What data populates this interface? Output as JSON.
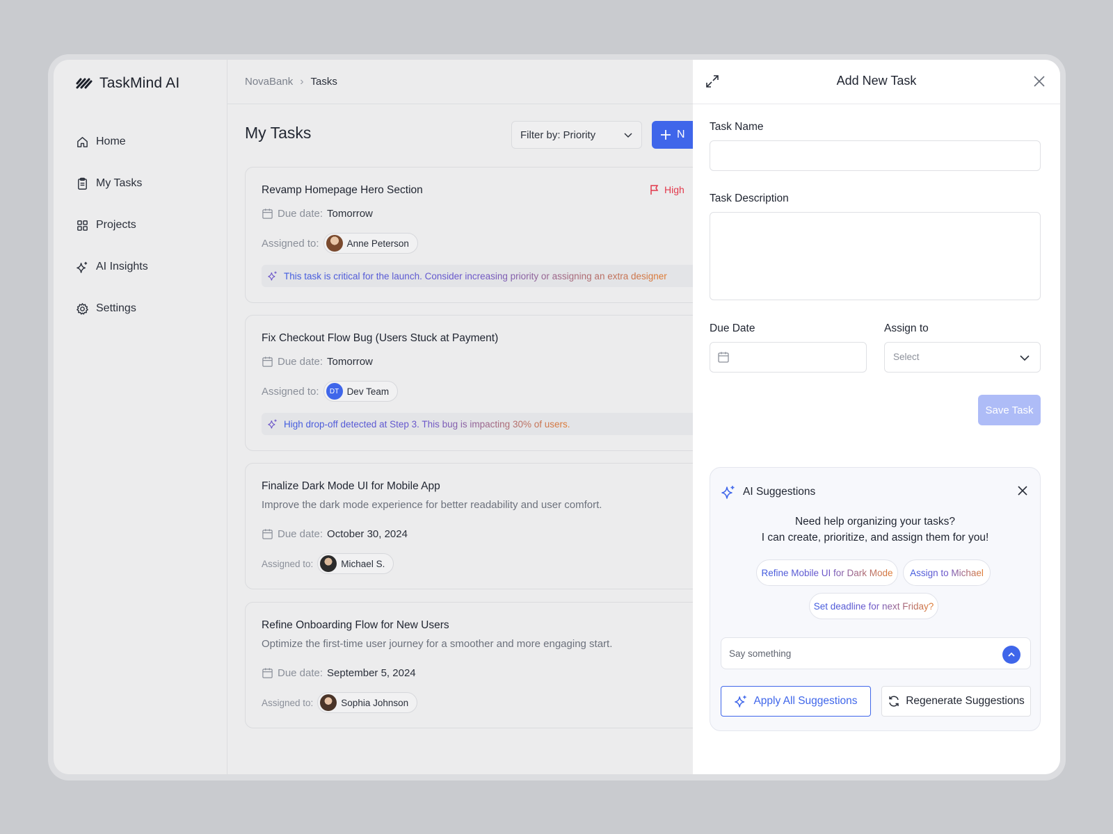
{
  "app": {
    "name": "TaskMind AI"
  },
  "sidebar": {
    "items": [
      {
        "label": "Home",
        "icon": "home-icon"
      },
      {
        "label": "My Tasks",
        "icon": "clipboard-icon"
      },
      {
        "label": "Projects",
        "icon": "grid-icon"
      },
      {
        "label": "AI Insights",
        "icon": "sparkle-icon"
      },
      {
        "label": "Settings",
        "icon": "gear-icon"
      }
    ]
  },
  "breadcrumb": {
    "parent": "NovaBank",
    "current": "Tasks"
  },
  "main": {
    "title": "My Tasks",
    "filter": {
      "prefix": "Filter by:",
      "value": "Priority"
    },
    "new_button": "N"
  },
  "tasks": [
    {
      "title": "Revamp Homepage Hero Section",
      "priority": "High",
      "due_label": "Due date:",
      "due_value": "Tomorrow",
      "assign_label": "Assigned to:",
      "assignee": "Anne Peterson",
      "hint": "This task is critical for the launch. Consider increasing priority or assigning an extra designer"
    },
    {
      "title": "Fix Checkout Flow Bug (Users Stuck at Payment)",
      "due_label": "Due date:",
      "due_value": "Tomorrow",
      "assign_label": "Assigned to:",
      "assignee": "Dev Team",
      "assignee_initials": "DT",
      "hint": "High drop-off detected at Step 3. This bug is impacting 30% of users."
    },
    {
      "title": "Finalize Dark Mode UI for Mobile App",
      "description": "Improve the dark mode experience for better readability and user comfort.",
      "due_label": "Due date:",
      "due_value": "October 30, 2024",
      "assign_label": "Assigned to:",
      "assignee": "Michael S."
    },
    {
      "title": "Refine Onboarding Flow for New Users",
      "description": "Optimize the first-time user journey for a smoother and more engaging start.",
      "due_label": "Due date:",
      "due_value": "September 5, 2024",
      "assign_label": "Assigned to:",
      "assignee": "Sophia Johnson"
    }
  ],
  "panel": {
    "title": "Add New Task",
    "task_name_label": "Task Name",
    "task_name_value": "",
    "description_label": "Task Description",
    "description_value": "",
    "due_date_label": "Due Date",
    "assign_label": "Assign to",
    "assign_placeholder": "Select",
    "save_button": "Save Task"
  },
  "ai": {
    "title": "AI Suggestions",
    "message_line1": "Need help organizing your tasks?",
    "message_line2": "I can create, prioritize, and assign them for you!",
    "suggestions": [
      "Refine Mobile UI for Dark Mode",
      "Assign to Michael",
      "Set deadline for next Friday?"
    ],
    "input_placeholder": "Say something",
    "apply_button": "Apply All Suggestions",
    "regenerate_button": "Regenerate Suggestions"
  },
  "colors": {
    "accent": "#3f66ea",
    "priority_high": "#e2384b",
    "save_disabled": "#aebcf7"
  }
}
